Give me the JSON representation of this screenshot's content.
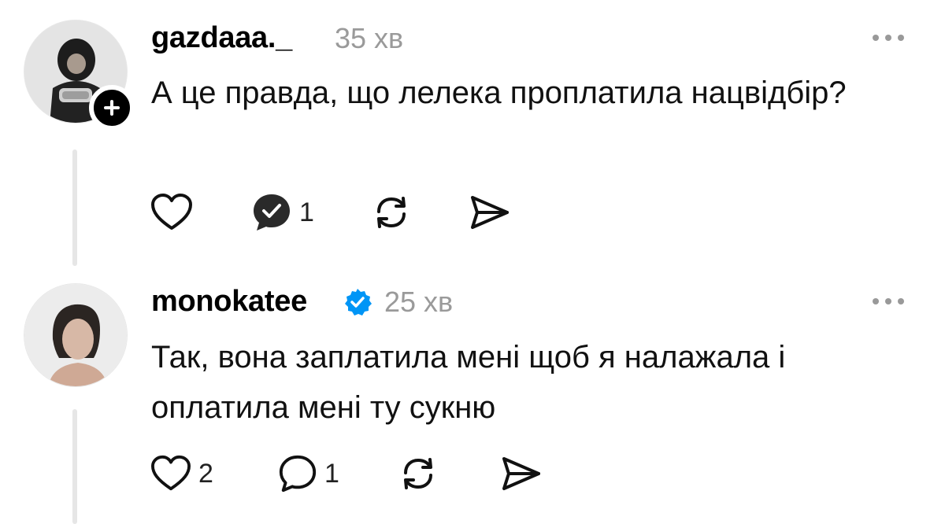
{
  "comments": [
    {
      "username": "gazdaaa._",
      "time": "35 хв",
      "text": "А це правда, що лелека проплатила нацвідбір?",
      "avatar_icon": "profile-photo",
      "follow_icon": "plus-icon",
      "reply_count": "1",
      "reply_icon_state": "replied-checkmark"
    },
    {
      "username": "monokatee",
      "verified": true,
      "time": "25 хв",
      "text": "Так, вона заплатила мені щоб я налажала і оплатила мені ту сукню",
      "avatar_icon": "profile-photo",
      "like_count": "2",
      "reply_count": "1"
    }
  ],
  "icons": [
    "heart-icon",
    "comment-icon",
    "repost-icon",
    "share-icon",
    "more-icon",
    "verified-icon"
  ],
  "colors": {
    "verified": "#0095f6",
    "meta_gray": "#9a9a9a",
    "thread_line": "#e6e6e6"
  }
}
